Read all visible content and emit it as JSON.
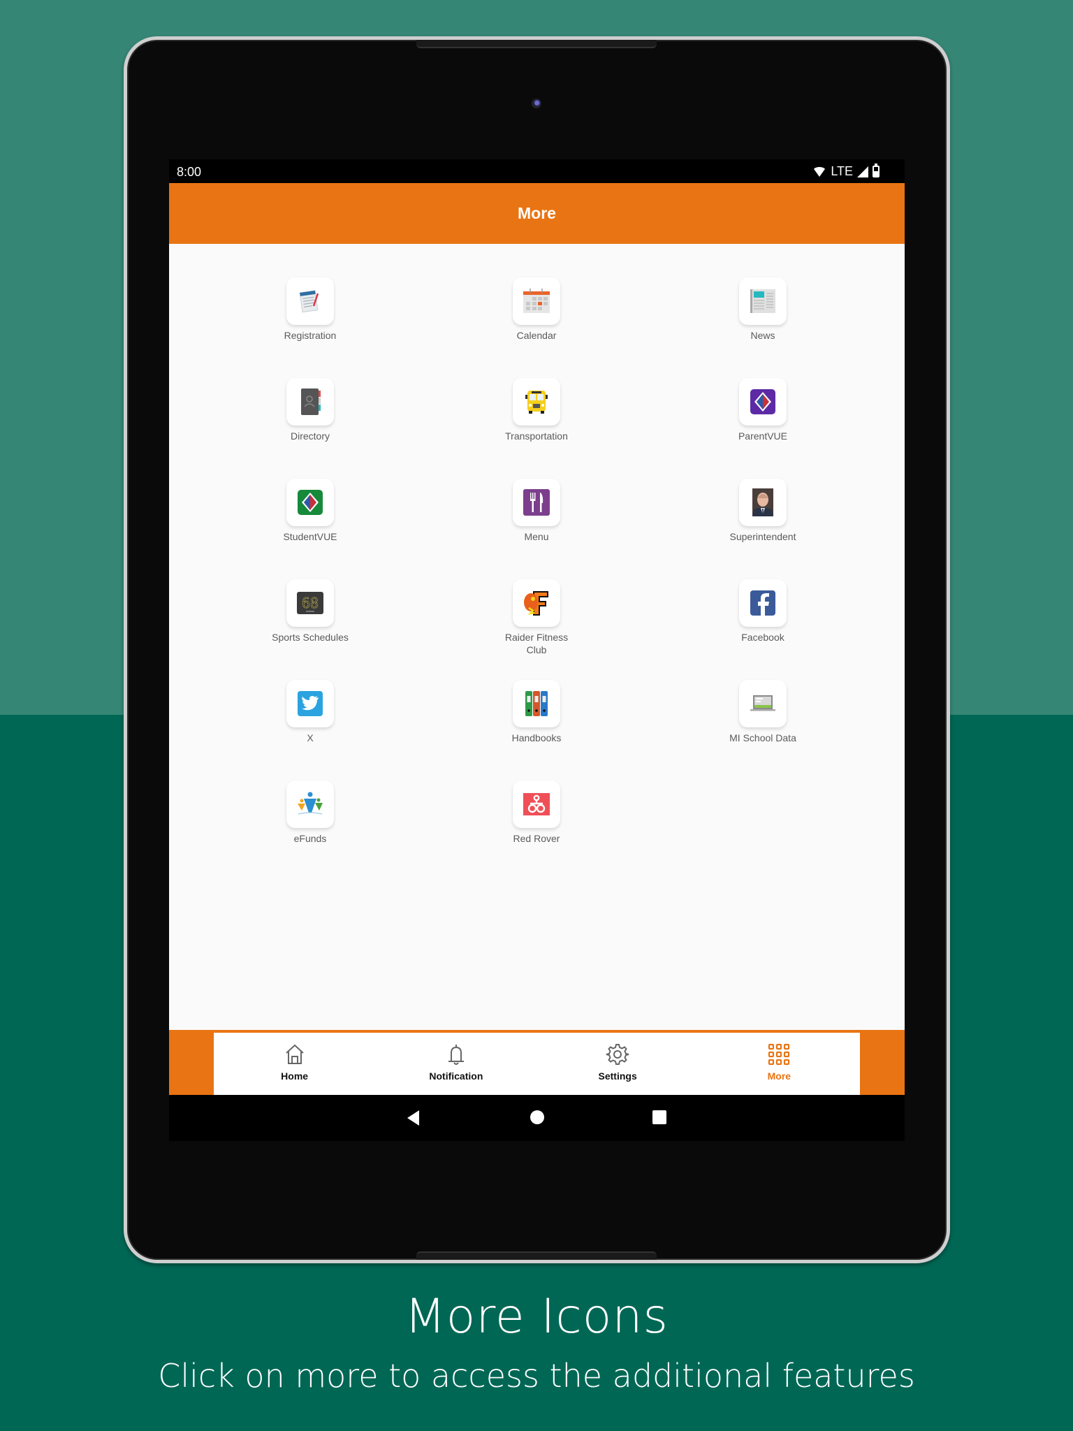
{
  "status_bar": {
    "time": "8:00",
    "network": "LTE"
  },
  "header": {
    "title": "More"
  },
  "grid_items": [
    {
      "label": "Registration",
      "icon": "registration-form-icon"
    },
    {
      "label": "Calendar",
      "icon": "calendar-icon"
    },
    {
      "label": "News",
      "icon": "newspaper-icon"
    },
    {
      "label": "Directory",
      "icon": "address-book-icon"
    },
    {
      "label": "Transportation",
      "icon": "school-bus-icon"
    },
    {
      "label": "ParentVUE",
      "icon": "parentvue-logo-icon"
    },
    {
      "label": "StudentVUE",
      "icon": "studentvue-logo-icon"
    },
    {
      "label": "Menu",
      "icon": "fork-knife-icon"
    },
    {
      "label": "Superintendent",
      "icon": "superintendent-photo-icon"
    },
    {
      "label": "Sports Schedules",
      "icon": "scoreboard-icon",
      "score": "68"
    },
    {
      "label": "Raider Fitness Club",
      "icon": "raider-logo-icon"
    },
    {
      "label": "Facebook",
      "icon": "facebook-icon"
    },
    {
      "label": "X",
      "icon": "twitter-bird-icon"
    },
    {
      "label": "Handbooks",
      "icon": "binders-icon"
    },
    {
      "label": "MI School Data",
      "icon": "laptop-icon"
    },
    {
      "label": "eFunds",
      "icon": "efunds-logo-icon"
    },
    {
      "label": "Red Rover",
      "icon": "red-rover-logo-icon"
    }
  ],
  "bottom_nav": {
    "tabs": [
      {
        "label": "Home",
        "icon": "home-icon",
        "active": false
      },
      {
        "label": "Notification",
        "icon": "bell-icon",
        "active": false
      },
      {
        "label": "Settings",
        "icon": "gear-icon",
        "active": false
      },
      {
        "label": "More",
        "icon": "grid-icon",
        "active": true
      }
    ]
  },
  "caption": {
    "title": "More Icons",
    "subtitle": "Click on more to access the additional features"
  },
  "colors": {
    "accent": "#e97413",
    "bg_top": "#368676",
    "bg_bottom": "#016755"
  }
}
